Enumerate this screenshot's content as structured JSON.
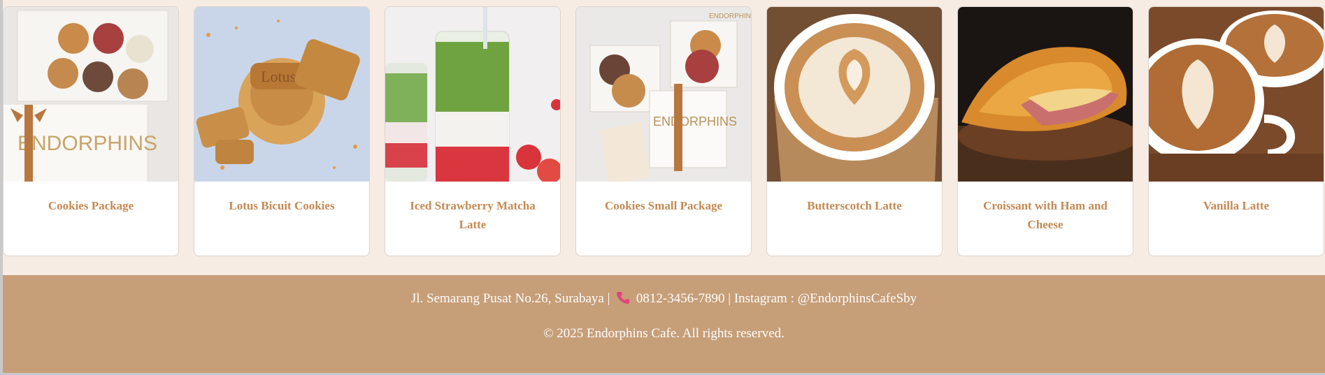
{
  "products": [
    {
      "name": "Cookies Package",
      "image": "cookies-package-photo"
    },
    {
      "name": "Lotus Bicuit Cookies",
      "image": "lotus-cookies-photo"
    },
    {
      "name": "Iced Strawberry Matcha Latte",
      "image": "iced-strawberry-matcha-photo"
    },
    {
      "name": "Cookies Small Package",
      "image": "cookies-small-package-photo"
    },
    {
      "name": "Butterscotch Latte",
      "image": "butterscotch-latte-photo"
    },
    {
      "name": "Croissant with Ham and Cheese",
      "image": "croissant-ham-cheese-photo"
    },
    {
      "name": "Vanilla Latte",
      "image": "vanilla-latte-photo"
    }
  ],
  "footer": {
    "address": "Jl. Semarang Pusat No.26, Surabaya |",
    "phone_icon": "phone-icon",
    "phone": "0812-3456-7890 | Instagram : @EndorphinsCafeSby",
    "copyright": "© 2025 Endorphins Cafe. All rights reserved."
  },
  "colors": {
    "page_bg": "#f6ece3",
    "footer_bg": "#c69e78",
    "product_name": "#c48a52"
  }
}
